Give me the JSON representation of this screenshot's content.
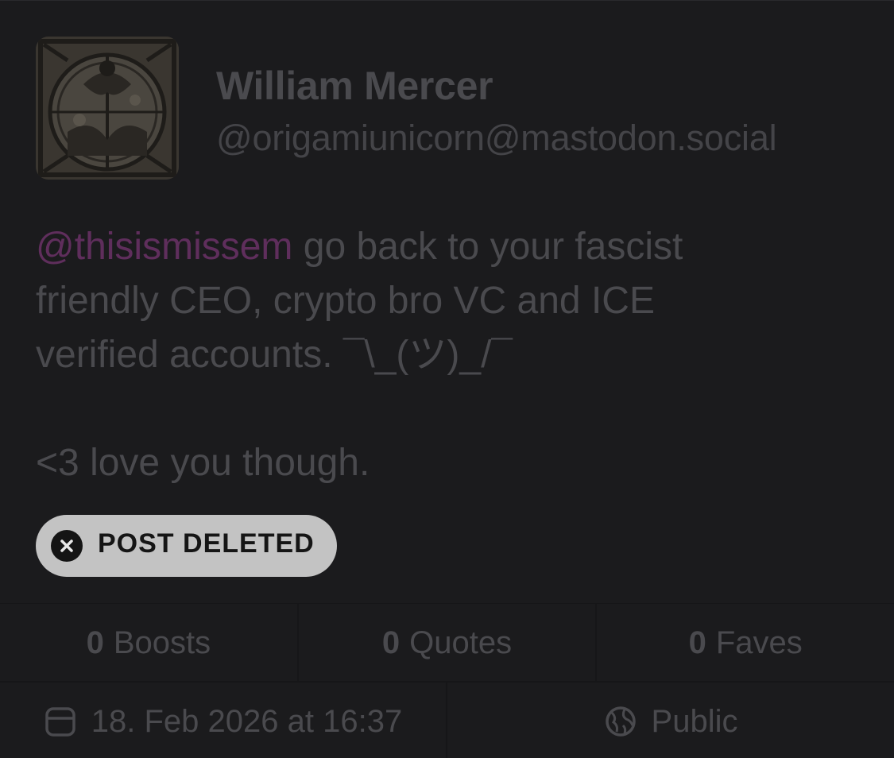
{
  "author": {
    "display_name": "William Mercer",
    "handle": "@origamiunicorn@mastodon.social",
    "avatar_icon": "engraving-avatar"
  },
  "post": {
    "mention": "@thisismissem",
    "line1_rest": " go back to your fascist",
    "line2": "friendly CEO, crypto bro VC and ICE",
    "line3": "verified accounts. ¯\\_(ツ)_/¯",
    "line4": "<3 love you though."
  },
  "status_badge": {
    "label": "POST DELETED",
    "icon": "close-circle-icon"
  },
  "stats": {
    "boosts_count": "0",
    "boosts_label": "Boosts",
    "quotes_count": "0",
    "quotes_label": "Quotes",
    "faves_count": "0",
    "faves_label": "Faves"
  },
  "meta": {
    "date": "18. Feb 2026 at 16:37",
    "date_icon": "calendar-icon",
    "visibility": "Public",
    "visibility_icon": "globe-icon"
  },
  "colors": {
    "background": "#1b1b1d",
    "mention": "#5f2e5c",
    "badge_bg": "#c3c3c3",
    "text": "#4a4a4e"
  }
}
